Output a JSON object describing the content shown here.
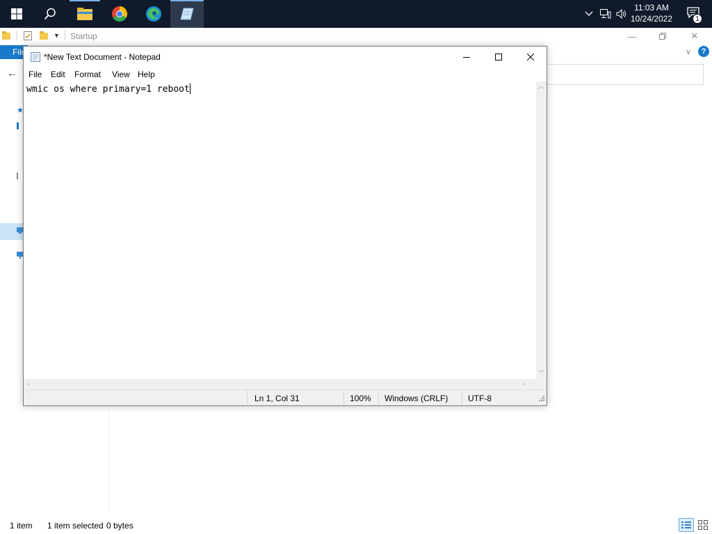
{
  "taskbar": {
    "start": "start-icon",
    "search": "search-icon",
    "apps": [
      {
        "name": "file-explorer-icon",
        "state": "running"
      },
      {
        "name": "chrome-icon",
        "state": "none"
      },
      {
        "name": "edge-icon",
        "state": "none"
      },
      {
        "name": "notepad-icon",
        "state": "active"
      }
    ],
    "tray_icons": [
      "chevron-up-icon",
      "network-icon",
      "volume-icon"
    ],
    "clock_time": "11:03 AM",
    "clock_date": "10/24/2022",
    "notification_count": "1"
  },
  "explorer": {
    "title": "Startup",
    "file_tab": "File",
    "status_items": "1 item",
    "status_selected": "1 item selected",
    "status_size": "0 bytes"
  },
  "notepad": {
    "title": "*New Text Document - Notepad",
    "menu": [
      "File",
      "Edit",
      "Format",
      "View",
      "Help"
    ],
    "content": "wmic os where primary=1 reboot",
    "status": {
      "position": "Ln 1, Col 31",
      "zoom": "100%",
      "line_ending": "Windows (CRLF)",
      "encoding": "UTF-8"
    }
  },
  "colors": {
    "taskbar": "#101a2a",
    "accent": "#1979ca",
    "selection": "#cce4f7"
  }
}
